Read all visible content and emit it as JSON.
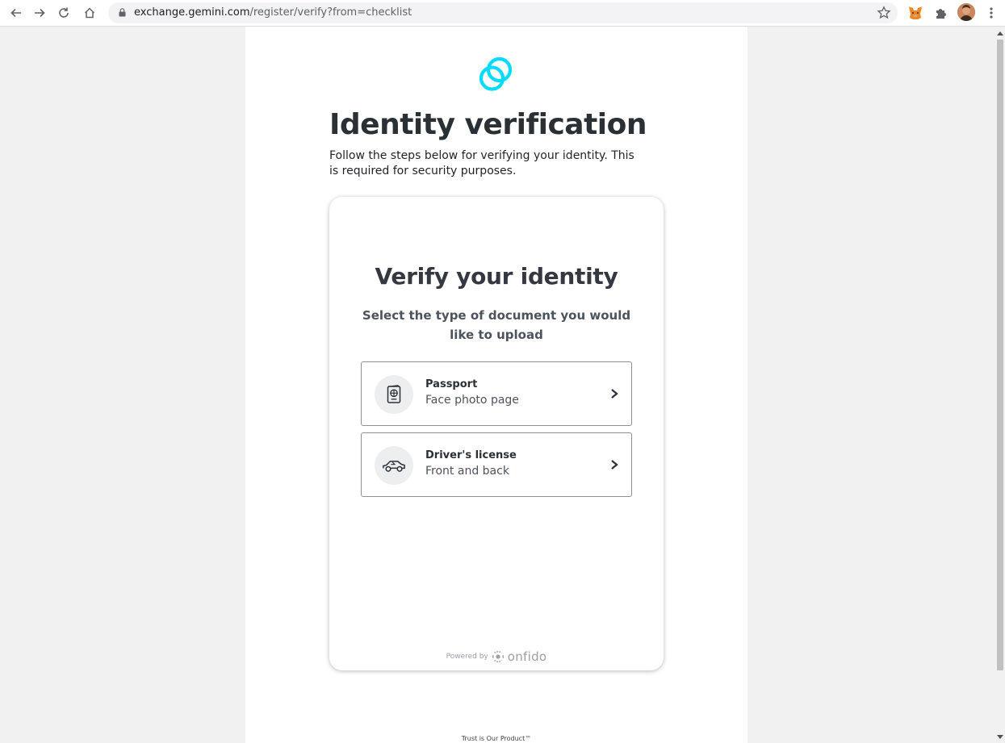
{
  "browser": {
    "url_host": "exchange.gemini.com",
    "url_path": "/register/verify?from=checklist"
  },
  "page": {
    "title": "Identity verification",
    "subtitle": "Follow the steps below for verifying your identity. This is required for security purposes.",
    "footer": "Trust is Our Product™"
  },
  "card": {
    "title": "Verify your identity",
    "subtitle": "Select the type of document you would like to upload",
    "options": [
      {
        "label": "Passport",
        "description": "Face photo page",
        "icon": "passport-icon"
      },
      {
        "label": "Driver's license",
        "description": "Front and back",
        "icon": "car-icon"
      }
    ],
    "powered_by": "Powered by",
    "provider": "onfido"
  },
  "colors": {
    "brand_logo": "#00dcfa",
    "title_text": "#2b3035",
    "card_border": "#8d9196"
  }
}
